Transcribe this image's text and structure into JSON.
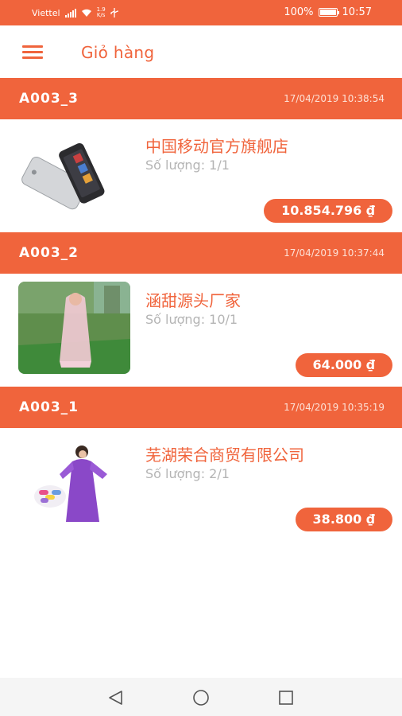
{
  "status_bar": {
    "carrier": "Viettel",
    "speed_value": "1.9",
    "speed_unit": "K/s",
    "battery": "100%",
    "battery_level": 1.0,
    "time": "10:57"
  },
  "app_bar": {
    "title": "Giỏ hàng",
    "menu_icon": "hamburger-menu-icon"
  },
  "orders": [
    {
      "code": "A003_3",
      "time": "17/04/2019 10:38:54",
      "product_name": "中国移动官方旗舰店",
      "quantity": "Số lượng: 1/1",
      "price": "10.854.796 ₫",
      "image": "smartphone-image"
    },
    {
      "code": "A003_2",
      "time": "17/04/2019 10:37:44",
      "product_name": "涵甜源头厂家",
      "quantity": "Số lượng: 10/1",
      "price": "64.000 ₫",
      "image": "raincoat-photo-image"
    },
    {
      "code": "A003_1",
      "time": "17/04/2019 10:35:19",
      "product_name": "芜湖荣合商贸有限公司",
      "quantity": "Số lượng: 2/1",
      "price": "38.800 ₫",
      "image": "purple-raincoat-image"
    }
  ],
  "nav_bar": {
    "back_icon": "back-triangle-icon",
    "home_icon": "home-circle-icon",
    "recents_icon": "recents-square-icon"
  },
  "colors": {
    "accent": "#f0643c",
    "muted_text": "#b4b4b4"
  }
}
